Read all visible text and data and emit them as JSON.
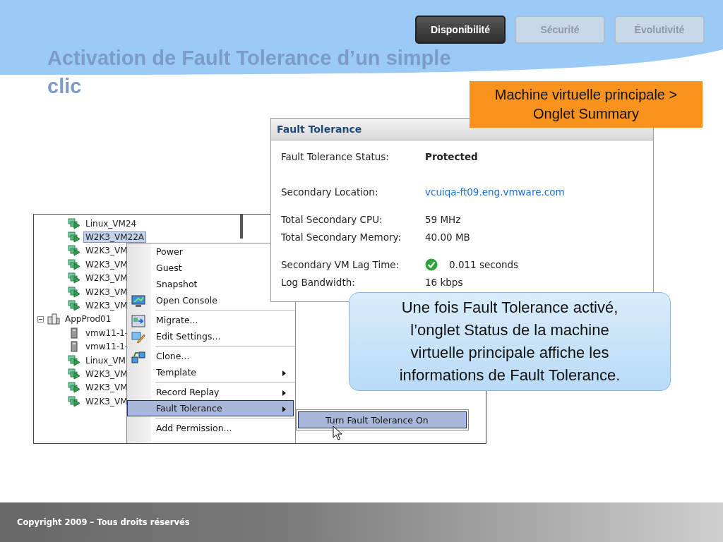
{
  "tabs": [
    {
      "label": "Disponibilité",
      "selected": true
    },
    {
      "label": "Sécurité",
      "selected": false
    },
    {
      "label": "Évolutivité",
      "selected": false
    }
  ],
  "title": "Activation de Fault Tolerance d’un simple clic",
  "callout_top": "Machine virtuelle principale > Onglet Summary",
  "ft_panel": {
    "title": "Fault Tolerance",
    "groups": [
      [
        {
          "label": "Fault Tolerance Status:",
          "value": "Protected",
          "kind": "bold"
        }
      ],
      [
        {
          "label": "Secondary Location:",
          "value": "vcuiqa-ft09.eng.vmware.com",
          "kind": "link"
        }
      ],
      [
        {
          "label": "Total Secondary CPU:",
          "value": "59 MHz",
          "kind": "plain"
        },
        {
          "label": "Total Secondary Memory:",
          "value": "40.00 MB",
          "kind": "plain"
        }
      ],
      [
        {
          "label": "Secondary VM Lag Time:",
          "value": "0.011 seconds",
          "kind": "status-ok"
        },
        {
          "label": "Log Bandwidth:",
          "value": "16 kbps",
          "kind": "plain"
        }
      ]
    ]
  },
  "tree": [
    {
      "label": "Linux_VM24",
      "kind": "vm",
      "selected": false
    },
    {
      "label": "W2K3_VM22A",
      "kind": "vm",
      "selected": true
    },
    {
      "label": "W2K3_VM",
      "kind": "vm",
      "selected": false
    },
    {
      "label": "W2K3_VM",
      "kind": "vm",
      "selected": false
    },
    {
      "label": "W2K3_VM",
      "kind": "vm",
      "selected": false
    },
    {
      "label": "W2K3_VM",
      "kind": "vm",
      "selected": false
    },
    {
      "label": "W2K3_VM",
      "kind": "vm",
      "selected": false
    },
    {
      "label": "AppProd01",
      "kind": "group",
      "selected": false,
      "expanded": true,
      "children": [
        {
          "label": "vmw11-1-",
          "kind": "host",
          "selected": false
        },
        {
          "label": "vmw11-1-",
          "kind": "host",
          "selected": false
        },
        {
          "label": "Linux_VM",
          "kind": "vm",
          "selected": false
        },
        {
          "label": "W2K3_VM",
          "kind": "vm",
          "selected": false
        },
        {
          "label": "W2K3_VM",
          "kind": "vm",
          "selected": false
        },
        {
          "label": "W2K3_VM",
          "kind": "vm",
          "selected": false
        }
      ]
    }
  ],
  "context_menu": [
    [
      {
        "label": "Power",
        "kind": "plain",
        "submenu": false,
        "selected": false
      },
      {
        "label": "Guest",
        "kind": "plain",
        "submenu": false,
        "selected": false
      },
      {
        "label": "Snapshot",
        "kind": "plain",
        "submenu": false,
        "selected": false
      },
      {
        "label": "Open Console",
        "kind": "console",
        "submenu": false,
        "selected": false
      }
    ],
    [
      {
        "label": "Migrate...",
        "kind": "migrate",
        "submenu": false,
        "selected": false
      },
      {
        "label": "Edit Settings...",
        "kind": "settings",
        "submenu": false,
        "selected": false
      }
    ],
    [
      {
        "label": "Clone...",
        "kind": "clone",
        "submenu": false,
        "selected": false
      },
      {
        "label": "Template",
        "kind": "plain",
        "submenu": true,
        "selected": false
      }
    ],
    [
      {
        "label": "Record Replay",
        "kind": "plain",
        "submenu": true,
        "selected": false
      },
      {
        "label": "Fault Tolerance",
        "kind": "plain",
        "submenu": true,
        "selected": true
      }
    ],
    [
      {
        "label": "Add Permission...",
        "kind": "plain",
        "submenu": false,
        "selected": false
      }
    ]
  ],
  "submenu": [
    {
      "label": "Turn Fault Tolerance On",
      "selected": true
    }
  ],
  "callout_bottom": "Une fois Fault Tolerance activé, l’onglet Status de la machine virtuelle principale affiche les informations de Fault Tolerance.",
  "footer": "Copyright 2009 – Tous droits réservés"
}
